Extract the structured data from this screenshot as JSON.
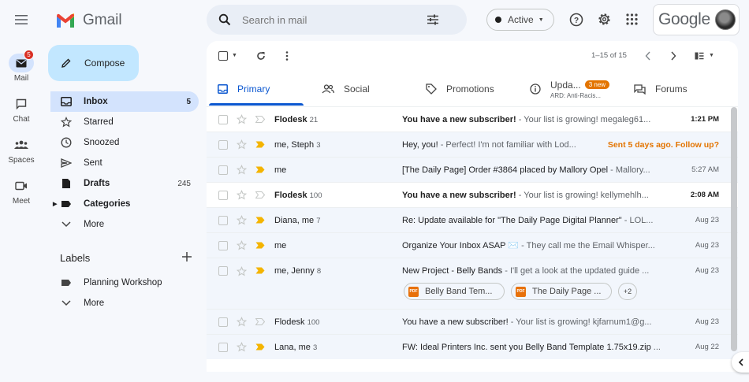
{
  "app": {
    "name": "Gmail",
    "brand": "Google"
  },
  "search": {
    "placeholder": "Search in mail"
  },
  "status": {
    "label": "Active"
  },
  "compose": {
    "label": "Compose"
  },
  "rail": [
    {
      "label": "Mail",
      "badge": "5"
    },
    {
      "label": "Chat"
    },
    {
      "label": "Spaces"
    },
    {
      "label": "Meet"
    }
  ],
  "nav": [
    {
      "label": "Inbox",
      "count": "5"
    },
    {
      "label": "Starred",
      "count": ""
    },
    {
      "label": "Snoozed",
      "count": ""
    },
    {
      "label": "Sent",
      "count": ""
    },
    {
      "label": "Drafts",
      "count": "245"
    },
    {
      "label": "Categories",
      "count": ""
    },
    {
      "label": "More",
      "count": ""
    }
  ],
  "labels": {
    "title": "Labels",
    "items": [
      "Planning Workshop",
      "More"
    ]
  },
  "toolbar": {
    "pagination": "1–15 of 15"
  },
  "tabs": [
    {
      "label": "Primary"
    },
    {
      "label": "Social"
    },
    {
      "label": "Promotions"
    },
    {
      "label": "Upda...",
      "badge": "3 new",
      "sub": "ARD: Anti-Racis..."
    },
    {
      "label": "Forums"
    }
  ],
  "emails": [
    {
      "sender": "Flodesk",
      "count": "21",
      "subject": "You have a new subscriber!",
      "snippet": " - Your list is growing! megaleg61...",
      "date": "1:21 PM",
      "unread": true,
      "important": false
    },
    {
      "sender": "me, Steph",
      "count": "3",
      "subject": "Hey, you!",
      "snippet": " - Perfect! I'm not familiar with Lod...",
      "date": "Sent 5 days ago. Follow up?",
      "unread": false,
      "important": true,
      "followup": true
    },
    {
      "sender": "me",
      "count": "",
      "subject": "[The Daily Page] Order #3864 placed by Mallory Opel",
      "snippet": " - Mallory...",
      "date": "5:27 AM",
      "unread": false,
      "important": true
    },
    {
      "sender": "Flodesk",
      "count": "100",
      "subject": "You have a new subscriber!",
      "snippet": " - Your list is growing! kellymehlh...",
      "date": "2:08 AM",
      "unread": true,
      "important": false
    },
    {
      "sender": "Diana, me",
      "count": "7",
      "subject": "Re: Update available for \"The Daily Page Digital Planner\"",
      "snippet": " - LOL...",
      "date": "Aug 23",
      "unread": false,
      "important": true
    },
    {
      "sender": "me",
      "count": "",
      "subject": "Organize Your Inbox ASAP ✉️",
      "snippet": " - They call me the Email Whisper...",
      "date": "Aug 23",
      "unread": false,
      "important": true
    },
    {
      "sender": "me, Jenny",
      "count": "8",
      "subject": "New Project - Belly Bands",
      "snippet": " - I'll get a look at the updated guide ...",
      "date": "Aug 23",
      "unread": false,
      "important": true
    },
    {
      "sender": "Flodesk",
      "count": "100",
      "subject": "You have a new subscriber!",
      "snippet": " - Your list is growing! kjfarnum1@g...",
      "date": "Aug 23",
      "unread": false,
      "important": false
    },
    {
      "sender": "Lana, me",
      "count": "3",
      "subject": "FW: Ideal Printers Inc. sent you Belly Band Template 1.75x19.zip",
      "snippet": " ...",
      "date": "Aug 22",
      "unread": false,
      "important": true
    }
  ],
  "attachments": [
    "Belly Band Tem...",
    "The Daily Page ...",
    "+2"
  ],
  "colors": {
    "accent": "#0b57d0",
    "followup": "#e37400",
    "important": "#f4b400",
    "badge": "#d93025"
  }
}
